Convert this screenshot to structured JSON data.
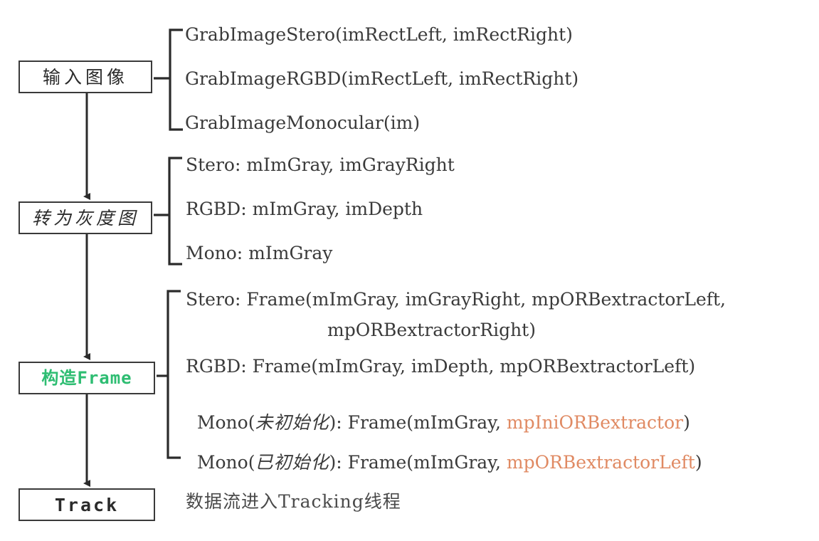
{
  "diagram": {
    "title_note": "ORB-SLAM2 image input to Tracking data flow",
    "colors": {
      "stroke": "#3a3a3a",
      "text": "#3a3a3a",
      "green_accent": "#2ebd72",
      "orange_accent": "#e08a63",
      "background": "#ffffff"
    }
  },
  "nodes": [
    {
      "id": "input-image",
      "label": "输入图像"
    },
    {
      "id": "to-grayscale",
      "label": "转为灰度图"
    },
    {
      "id": "build-frame",
      "label": "构造Frame"
    },
    {
      "id": "track",
      "label": "Track"
    }
  ],
  "groups": [
    {
      "id": "grab-image-group",
      "lines": [
        {
          "text": "GrabImageStero(imRectLeft, imRectRight)"
        },
        {
          "text": "GrabImageRGBD(imRectLeft, imRectRight)"
        },
        {
          "text": "GrabImageMonocular(im)"
        }
      ]
    },
    {
      "id": "grayscale-group",
      "lines": [
        {
          "text": "Stero: mImGray, imGrayRight"
        },
        {
          "text": "RGBD: mImGray, imDepth"
        },
        {
          "text": "Mono: mImGray"
        }
      ]
    },
    {
      "id": "frame-group",
      "lines": [
        {
          "text": "Stero: Frame(mImGray, imGrayRight, mpORBextractorLeft,"
        },
        {
          "text": "mpORBextractorRight)"
        },
        {
          "text": "RGBD: Frame(mImGray, imDepth, mpORBextractorLeft)"
        },
        {
          "prefix": "Mono(",
          "cn": "未初始化",
          "mid": "): Frame(mImGray, ",
          "hl": "mpIniORBextractor",
          "suffix": ")"
        },
        {
          "prefix": "Mono(",
          "cn": "已初始化",
          "mid": "): Frame(mImGray, ",
          "hl": "mpORBextractorLeft",
          "suffix": ")"
        }
      ]
    }
  ],
  "bottom_note": {
    "text": "数据流进入Tracking线程"
  }
}
